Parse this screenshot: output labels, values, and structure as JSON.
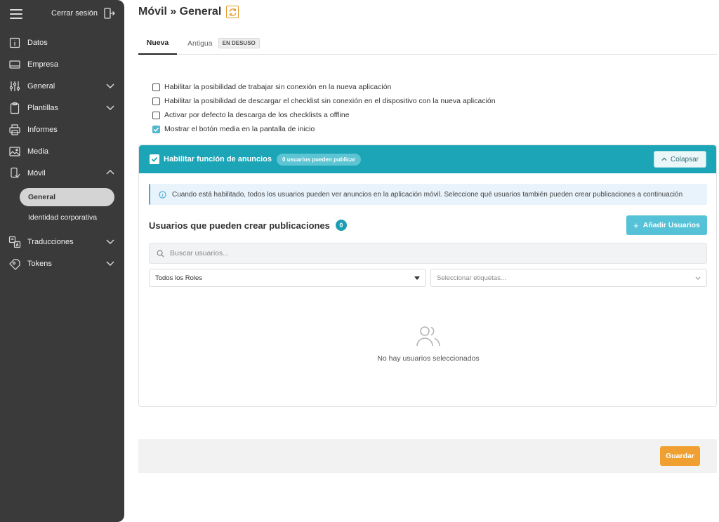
{
  "sidebar": {
    "logout_label": "Cerrar sesión",
    "items": [
      {
        "label": "Datos",
        "icon": "info-icon"
      },
      {
        "label": "Empresa",
        "icon": "building-icon"
      },
      {
        "label": "General",
        "icon": "sliders-icon"
      },
      {
        "label": "Plantillas",
        "icon": "clipboard-icon"
      },
      {
        "label": "Informes",
        "icon": "printer-icon"
      },
      {
        "label": "Media",
        "icon": "image-icon"
      },
      {
        "label": "Móvil",
        "icon": "mobile-icon"
      },
      {
        "label": "Traducciones",
        "icon": "translate-icon"
      },
      {
        "label": "Tokens",
        "icon": "tag-icon"
      }
    ],
    "sub_items": [
      {
        "label": "General",
        "active": true
      },
      {
        "label": "Identidad corporativa",
        "active": false
      }
    ]
  },
  "page": {
    "title": "Móvil » General"
  },
  "tabs": {
    "new_label": "Nueva",
    "old_label": "Antigua",
    "deprecated_badge": "EN DESUSO"
  },
  "options": [
    {
      "label": "Habilitar la posibilidad de trabajar sin conexión en la nueva aplicación",
      "checked": false
    },
    {
      "label": "Habilitar la posibilidad de descargar el checklist sin conexión en el dispositivo con la nueva aplicación",
      "checked": false
    },
    {
      "label": "Activar por defecto la descarga de los checklists a offline",
      "checked": false
    },
    {
      "label": "Mostrar el botón media en la pantalla de inicio",
      "checked": true
    }
  ],
  "announcements": {
    "title": "Habilitar función de anuncios",
    "enabled": true,
    "badge": "0 usuarios pueden publicar",
    "collapse_label": "Colapsar",
    "info_text": "Cuando está habilitado, todos los usuarios pueden ver anuncios en la aplicación móvil. Seleccione qué usuarios también pueden crear publicaciones a continuación",
    "users_title": "Usuarios que pueden crear publicaciones",
    "users_count": "0",
    "add_button": "Añadir Usuarios",
    "search_placeholder": "Buscar usuarios...",
    "roles_select": "Todos los Roles",
    "tags_placeholder": "Seleccionar etiquetas...",
    "empty_text": "No hay usuarios seleccionados"
  },
  "footer": {
    "save_label": "Guardar"
  },
  "colors": {
    "sidebar_bg": "#3a3a3a",
    "accent_teal": "#1ca5b7",
    "button_teal": "#55c2d8",
    "save_orange": "#f0a030"
  }
}
